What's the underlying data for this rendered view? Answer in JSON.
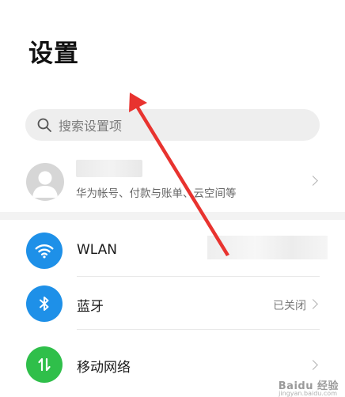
{
  "header": {
    "title": "设置"
  },
  "search": {
    "placeholder": "搜索设置项"
  },
  "account": {
    "subtitle": "华为帐号、付款与账单、云空间等"
  },
  "settings_items": [
    {
      "label": "WLAN",
      "value": "",
      "icon": "wifi-icon",
      "icon_color": "#1e90e8"
    },
    {
      "label": "蓝牙",
      "value": "已关闭",
      "icon": "bluetooth-icon",
      "icon_color": "#1e90e8"
    },
    {
      "label": "移动网络",
      "value": "",
      "icon": "mobile-data-icon",
      "icon_color": "#2fbf4a"
    }
  ],
  "colors": {
    "accent_blue": "#1e90e8",
    "accent_green": "#2fbf4a",
    "annotation_arrow": "#e8332f"
  },
  "watermark": {
    "text": "Baidu 经验",
    "sub": "jingyan.baidu.com"
  }
}
